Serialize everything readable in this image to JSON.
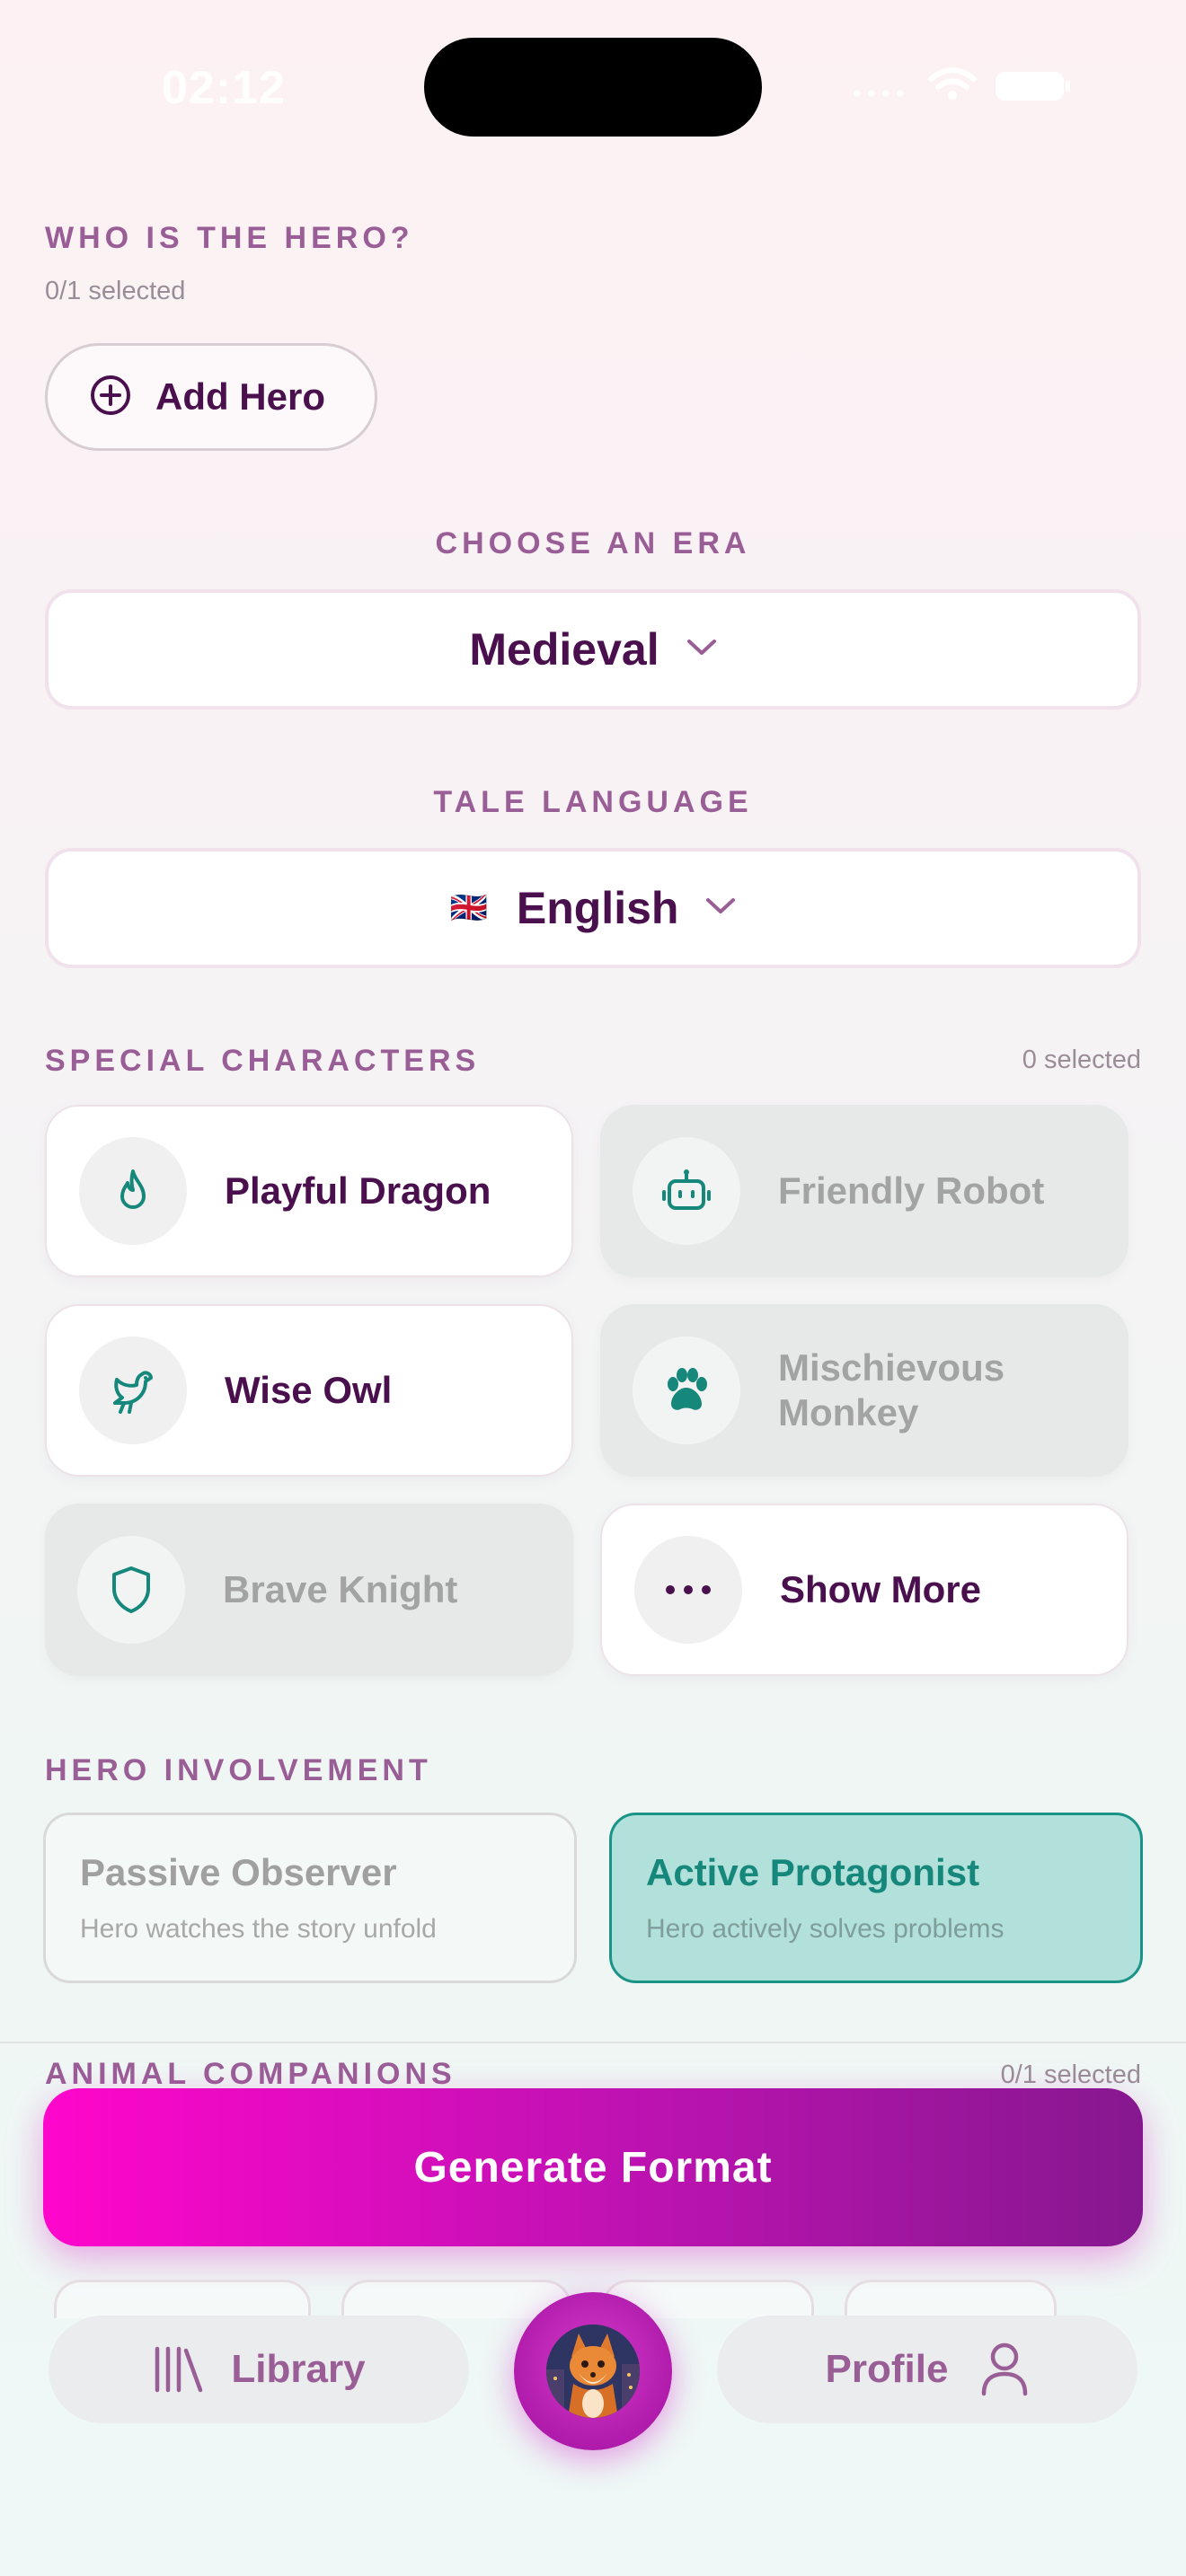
{
  "status_bar": {
    "time": "02:12"
  },
  "hero_section": {
    "title": "WHO IS THE HERO?",
    "selected_count": "0/1 selected",
    "add_button_label": "Add Hero"
  },
  "era": {
    "title": "CHOOSE AN ERA",
    "value": "Medieval"
  },
  "language": {
    "title": "TALE LANGUAGE",
    "flag": "🇬🇧",
    "value": "English"
  },
  "special_characters": {
    "title": "SPECIAL CHARACTERS",
    "selected_count": "0 selected",
    "items": [
      {
        "label": "Playful Dragon",
        "icon": "flame-icon",
        "state": "enabled"
      },
      {
        "label": "Friendly Robot",
        "icon": "robot-icon",
        "state": "disabled"
      },
      {
        "label": "Wise Owl",
        "icon": "bird-icon",
        "state": "enabled"
      },
      {
        "label": "Mischievous Monkey",
        "icon": "paw-icon",
        "state": "disabled"
      },
      {
        "label": "Brave Knight",
        "icon": "shield-icon",
        "state": "disabled"
      },
      {
        "label": "Show More",
        "icon": "more-icon",
        "state": "enabled"
      }
    ]
  },
  "hero_involvement": {
    "title": "HERO INVOLVEMENT",
    "options": [
      {
        "title": "Passive Observer",
        "description": "Hero watches the story unfold",
        "selected": false
      },
      {
        "title": "Active Protagonist",
        "description": "Hero actively solves problems",
        "selected": true
      }
    ]
  },
  "animal_companions": {
    "title": "ANIMAL COMPANIONS",
    "selected_count": "0/1 selected"
  },
  "generate_button": {
    "label": "Generate Format"
  },
  "bottom_nav": {
    "library_label": "Library",
    "profile_label": "Profile"
  },
  "colors": {
    "accent": "#4a0f4d",
    "label": "#9a5e97",
    "teal": "#15877b",
    "generate_start": "#ff06cc",
    "generate_end": "#86188f"
  }
}
